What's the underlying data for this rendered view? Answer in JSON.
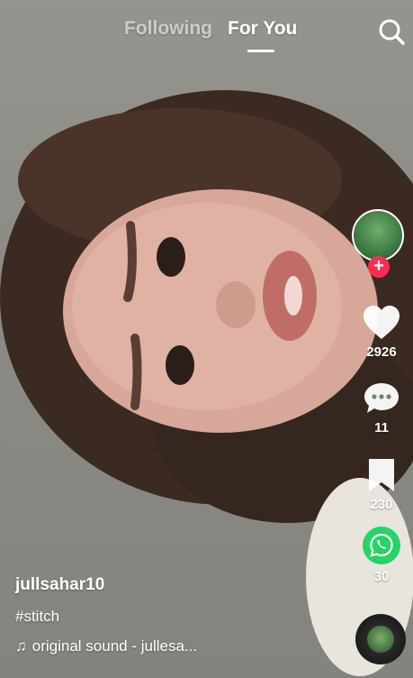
{
  "nav": {
    "following_label": "Following",
    "foryou_label": "For You",
    "active_tab": "For You",
    "search_icon": "search-icon"
  },
  "rail": {
    "avatar_icon": "avatar",
    "follow_icon": "plus-icon",
    "like_count": "2926",
    "comment_count": "11",
    "bookmark_count": "230",
    "share_count": "30",
    "share_icon": "whatsapp-icon"
  },
  "caption": {
    "username": "jullsahar10",
    "hashtag": "#stitch",
    "sound": "original sound - jullesa..."
  },
  "colors": {
    "accent": "#fe2c55",
    "whatsapp": "#25d366",
    "text": "#ffffff"
  }
}
